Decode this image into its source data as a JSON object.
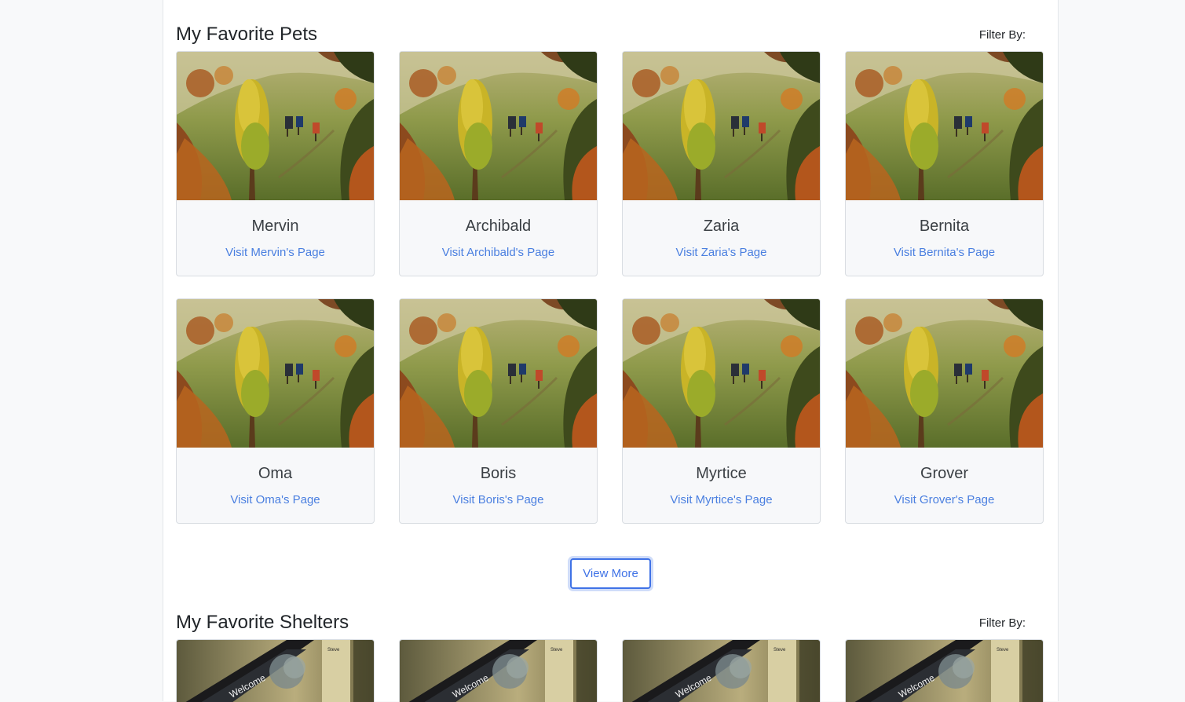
{
  "pets_section": {
    "title": "My Favorite Pets",
    "filter_label": "Filter By:",
    "cards": [
      {
        "name": "Mervin",
        "link": "Visit Mervin's Page"
      },
      {
        "name": "Archibald",
        "link": "Visit Archibald's Page"
      },
      {
        "name": "Zaria",
        "link": "Visit Zaria's Page"
      },
      {
        "name": "Bernita",
        "link": "Visit Bernita's Page"
      },
      {
        "name": "Oma",
        "link": "Visit Oma's Page"
      },
      {
        "name": "Boris",
        "link": "Visit Boris's Page"
      },
      {
        "name": "Myrtice",
        "link": "Visit Myrtice's Page"
      },
      {
        "name": "Grover",
        "link": "Visit Grover's Page"
      }
    ],
    "view_more_label": "View More"
  },
  "shelters_section": {
    "title": "My Favorite Shelters",
    "filter_label": "Filter By:",
    "cards": [
      {
        "photo_text": "Welcome",
        "photo_label": "Steve"
      },
      {
        "photo_text": "Welcome",
        "photo_label": "Steve"
      },
      {
        "photo_text": "Welcome",
        "photo_label": "Steve"
      },
      {
        "photo_text": "Welcome",
        "photo_label": "Steve"
      }
    ]
  }
}
